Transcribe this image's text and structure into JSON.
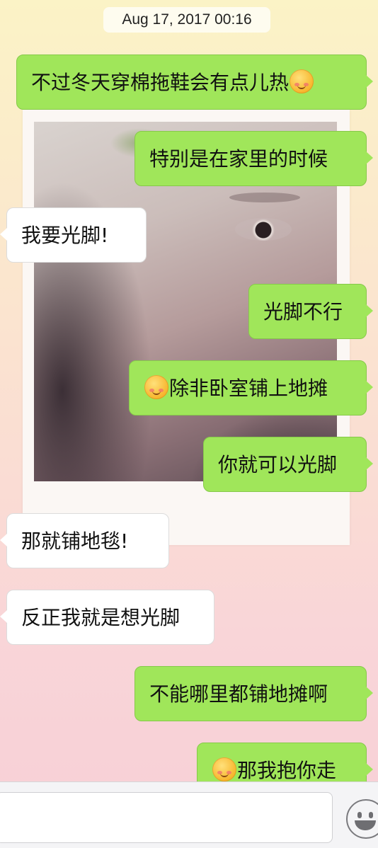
{
  "header": {
    "timestamp": "Aug 17, 2017 00:16"
  },
  "messages": [
    {
      "side": "sent",
      "text": "不过冬天穿棉拖鞋会有点儿热",
      "emoji_after": "blush-smile-emoji"
    },
    {
      "side": "sent",
      "text": "特别是在家里的时候"
    },
    {
      "side": "received",
      "text": "我要光脚!"
    },
    {
      "side": "sent",
      "text": "光脚不行"
    },
    {
      "side": "sent",
      "text": "除非卧室铺上地摊",
      "emoji_before": "blush-smile-emoji"
    },
    {
      "side": "sent",
      "text": "你就可以光脚"
    },
    {
      "side": "received",
      "text": "那就铺地毯!"
    },
    {
      "side": "received",
      "text": "反正我就是想光脚"
    },
    {
      "side": "sent",
      "text": "不能哪里都铺地摊啊"
    },
    {
      "side": "sent",
      "text": "那我抱你走",
      "emoji_before": "blush-smile-emoji"
    }
  ],
  "colors": {
    "sent_bubble": "#a0e65a",
    "received_bubble": "#ffffff",
    "background_top": "#fbf3c6",
    "background_bottom": "#f7cfd6"
  },
  "input_bar": {
    "placeholder": "",
    "emoji_button_icon": "smiley-face-icon"
  }
}
